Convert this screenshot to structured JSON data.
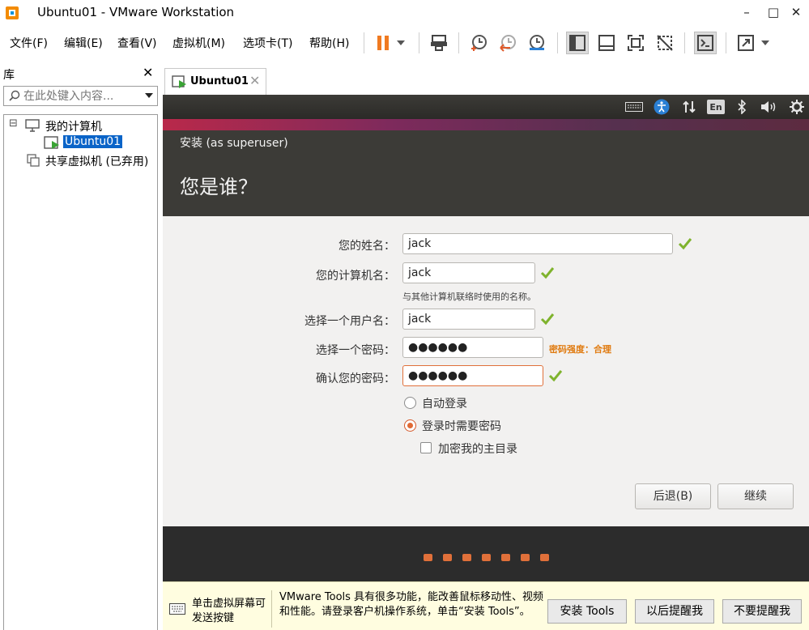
{
  "window": {
    "title": "Ubuntu01 - VMware Workstation",
    "minimize": "–",
    "maximize": "□",
    "close": "✕"
  },
  "menu": [
    "文件(F)",
    "编辑(E)",
    "查看(V)",
    "虚拟机(M)",
    "选项卡(T)",
    "帮助(H)"
  ],
  "library": {
    "title": "库",
    "close": "✕",
    "search_placeholder": "在此处键入内容...",
    "tree": {
      "my_computer": "我的计算机",
      "vm": "Ubuntu01",
      "shared": "共享虚拟机 (已弃用)",
      "collapse_glyph": "⊟"
    }
  },
  "tab": {
    "label": "Ubuntu01",
    "close": "✕"
  },
  "guest": {
    "tray_lang": "En",
    "installer": {
      "subtitle": "安装 (as superuser)",
      "title": "您是谁？",
      "name_label": "您的姓名：",
      "name_value": "jack",
      "computer_label": "您的计算机名：",
      "computer_value": "jack",
      "computer_hint": "与其他计算机联络时使用的名称。",
      "username_label": "选择一个用户名：",
      "username_value": "jack",
      "password_label": "选择一个密码：",
      "password_value": "●●●●●●",
      "password_strength": "密码强度：合理",
      "confirm_label": "确认您的密码：",
      "confirm_value": "●●●●●●",
      "auto_login": "自动登录",
      "require_password": "登录时需要密码",
      "encrypt_home": "加密我的主目录",
      "back_button": "后退(B)",
      "continue_button": "继续"
    },
    "progress_dots": 7
  },
  "notification": {
    "left_text": "单击虚拟屏幕可发送按键",
    "message": "VMware Tools 具有很多功能，能改善鼠标移动性、视频和性能。请登录客户机操作系统，单击“安装 Tools”。",
    "install_button": "安装 Tools",
    "remind_later_button": "以后提醒我",
    "never_remind_button": "不要提醒我"
  },
  "colors": {
    "accent_orange": "#e0703a",
    "ubuntu_header": "#3c3b37",
    "selection_blue": "#0a64c8",
    "check_green": "#7fb32d"
  }
}
